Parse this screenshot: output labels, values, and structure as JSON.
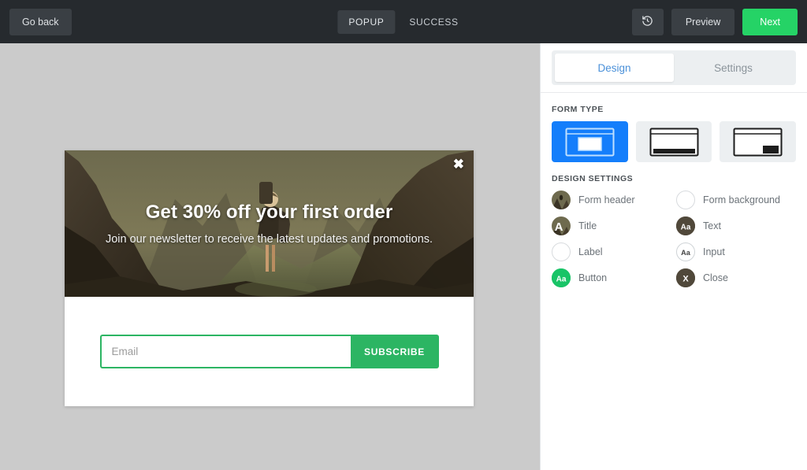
{
  "topbar": {
    "go_back_label": "Go back",
    "history_icon": "history-undo-icon",
    "preview_label": "Preview",
    "next_label": "Next",
    "next_color": "#25d366",
    "tabs": [
      {
        "label": "POPUP",
        "active": true
      },
      {
        "label": "SUCCESS",
        "active": false
      }
    ]
  },
  "canvas": {
    "background_color": "#cbcbcb",
    "popup": {
      "title": "Get 30% off your first order",
      "subtitle": "Join our newsletter to receive the latest updates and promotions.",
      "close_icon": "close-x-icon",
      "email_placeholder": "Email",
      "email_value": "",
      "subscribe_label": "SUBSCRIBE",
      "accent_color": "#2cb563"
    }
  },
  "panel": {
    "tabs": [
      {
        "label": "Design",
        "active": true
      },
      {
        "label": "Settings",
        "active": false
      }
    ],
    "active_tab_color": "#4a90d9",
    "form_type": {
      "section_label": "FORM TYPE",
      "selected_color": "#147efb",
      "options": [
        {
          "name": "popup-center",
          "selected": true
        },
        {
          "name": "bottom-bar",
          "selected": false
        },
        {
          "name": "corner-box",
          "selected": false
        }
      ]
    },
    "design_settings": {
      "section_label": "DESIGN SETTINGS",
      "items": [
        {
          "label": "Form header",
          "swatch": "image-thumb",
          "glyph": ""
        },
        {
          "label": "Form background",
          "swatch": "empty",
          "glyph": ""
        },
        {
          "label": "Title",
          "swatch": "image-letter",
          "glyph": "A"
        },
        {
          "label": "Text",
          "swatch": "dark",
          "glyph": "Aa"
        },
        {
          "label": "Label",
          "swatch": "empty",
          "glyph": ""
        },
        {
          "label": "Input",
          "swatch": "input",
          "glyph": "Aa"
        },
        {
          "label": "Button",
          "swatch": "green",
          "glyph": "Aa"
        },
        {
          "label": "Close",
          "swatch": "dark",
          "glyph": "X"
        }
      ]
    }
  }
}
